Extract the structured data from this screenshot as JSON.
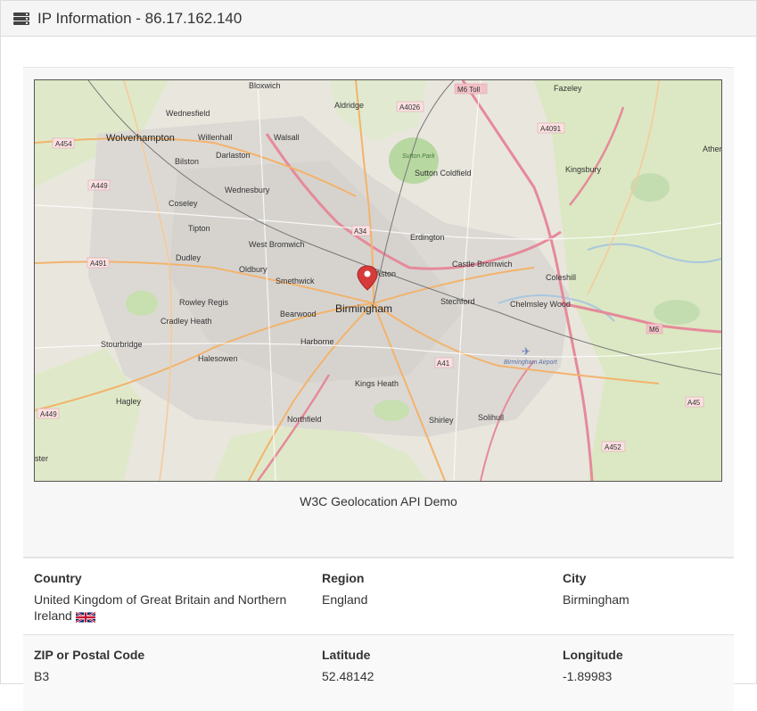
{
  "header": {
    "title": "IP Information - 86.17.162.140",
    "icon": "server-list-icon"
  },
  "map": {
    "caption": "W3C Geolocation API Demo",
    "marker_icon": "location-pin-icon",
    "places": {
      "bloxwich": "Bloxwich",
      "aldridge": "Aldridge",
      "fazeley": "Fazeley",
      "wednesfield": "Wednesfield",
      "wolverhampton": "Wolverhampton",
      "willenhall": "Willenhall",
      "walsall": "Walsall",
      "bilston": "Bilston",
      "darlaston": "Darlaston",
      "wednesbury": "Wednesbury",
      "coseley": "Coseley",
      "tipton": "Tipton",
      "dudley": "Dudley",
      "oldbury": "Oldbury",
      "west_bromwich": "West Bromwich",
      "smethwick": "Smethwick",
      "rowley_regis": "Rowley Regis",
      "cradley_heath": "Cradley Heath",
      "stourbridge": "Stourbridge",
      "halesowen": "Halesowen",
      "hagley": "Hagley",
      "bearwood": "Bearwood",
      "harborne": "Harborne",
      "birmingham": "Birmingham",
      "aston": "Aston",
      "erdington": "Erdington",
      "sutton_coldfield": "Sutton Coldfield",
      "sutton_park": "Sutton Park",
      "castle_bromwich": "Castle Bromwich",
      "kingsbury": "Kingsbury",
      "coleshill": "Coleshill",
      "stechford": "Stechford",
      "chelmsley_wood": "Chelmsley Wood",
      "birmingham_airport": "Birmingham Airport",
      "kings_heath": "Kings Heath",
      "northfield": "Northfield",
      "shirley": "Shirley",
      "solihull": "Solihull",
      "atherstone": "Ather",
      "leicester": "ster"
    },
    "roads": {
      "a454": "A454",
      "a449_n": "A449",
      "a491": "A491",
      "a449_s": "A449",
      "a4026": "A4026",
      "m6toll": "M6 Toll",
      "a4091": "A4091",
      "a34": "A34",
      "a41": "A41",
      "m6": "M6",
      "a45": "A45",
      "a452": "A452"
    }
  },
  "details": {
    "rows": [
      {
        "col1": {
          "label": "Country",
          "value": "United Kingdom of Great Britain and Northern Ireland"
        },
        "col2": {
          "label": "Region",
          "value": "England"
        },
        "col3": {
          "label": "City",
          "value": "Birmingham"
        }
      },
      {
        "col1": {
          "label": "ZIP or Postal Code",
          "value": "B3"
        },
        "col2": {
          "label": "Latitude",
          "value": "52.48142"
        },
        "col3": {
          "label": "Longitude",
          "value": "-1.89983"
        }
      }
    ],
    "flag_icon": "uk-flag-icon"
  }
}
